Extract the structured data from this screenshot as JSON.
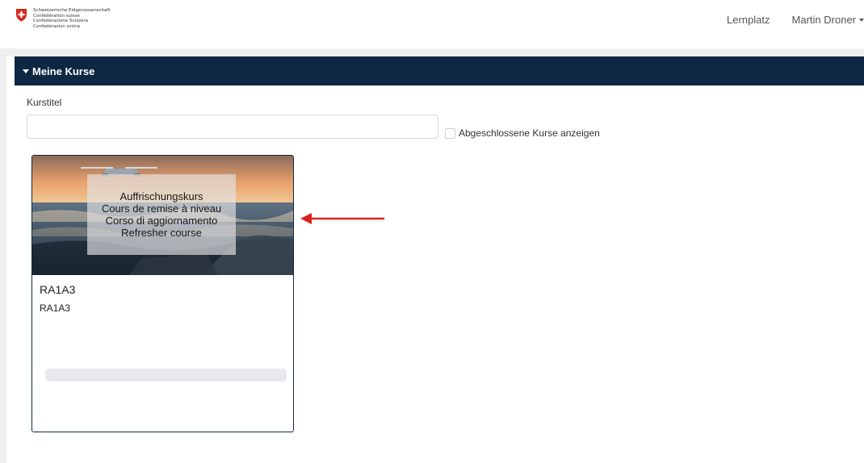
{
  "header": {
    "logo_lines": [
      "Schweizerische Eidgenossenschaft",
      "Confédération suisse",
      "Confederazione Svizzera",
      "Confederaziun svizra"
    ],
    "nav": {
      "lernplatz": "Lernplatz",
      "user": "Martin Droner"
    }
  },
  "section": {
    "title": "Meine Kurse"
  },
  "filter": {
    "label": "Kurstitel",
    "value": "",
    "placeholder": "",
    "checkbox_label": "Abgeschlossene Kurse anzeigen",
    "checkbox_checked": false
  },
  "course": {
    "image_lines": [
      "Auffrischungskurs",
      "Cours de remise à niveau",
      "Corso di aggiornamento",
      "Refresher course"
    ],
    "title": "RA1A3",
    "subtitle": "RA1A3",
    "progress": 0
  },
  "colors": {
    "brand_navy": "#0e2843",
    "swiss_red": "#d52b1e",
    "annotation_red": "#e02020"
  },
  "icons": [
    "swiss-cross-icon",
    "caret-down-icon",
    "triangle-down-icon",
    "annotation-arrow-icon"
  ]
}
